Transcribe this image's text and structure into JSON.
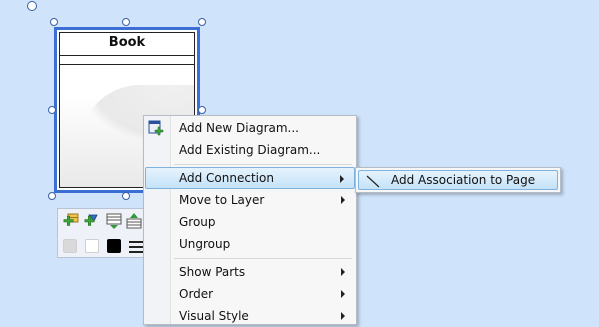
{
  "diagram": {
    "class_name": "Book"
  },
  "context_menu": {
    "items": [
      {
        "label": "Add New Diagram...",
        "icon": "add-diagram-icon",
        "has_submenu": false
      },
      {
        "label": "Add Existing Diagram...",
        "icon": "",
        "has_submenu": false
      },
      {
        "label": "Add Connection",
        "icon": "",
        "has_submenu": true,
        "highlighted": true
      },
      {
        "label": "Move to Layer",
        "icon": "",
        "has_submenu": true
      },
      {
        "label": "Group",
        "icon": "",
        "has_submenu": false
      },
      {
        "label": "Ungroup",
        "icon": "",
        "has_submenu": false
      },
      {
        "label": "Show Parts",
        "icon": "",
        "has_submenu": true
      },
      {
        "label": "Order",
        "icon": "",
        "has_submenu": true
      },
      {
        "label": "Visual Style",
        "icon": "",
        "has_submenu": true
      }
    ]
  },
  "submenu": {
    "items": [
      {
        "label": "Add Association to Page",
        "icon": "association-line-icon"
      }
    ]
  },
  "mini_toolbar": {
    "icons": [
      "add-attribute-icon",
      "add-operation-icon",
      "compartment-icon",
      "compartment-up-icon"
    ],
    "swatches": [
      "#d9d9d9",
      "#ffffff",
      "#000000"
    ]
  },
  "colors": {
    "canvas": "#cfe3fb",
    "selection": "#3b6fd6",
    "menu_highlight": "#c4e2f8"
  }
}
